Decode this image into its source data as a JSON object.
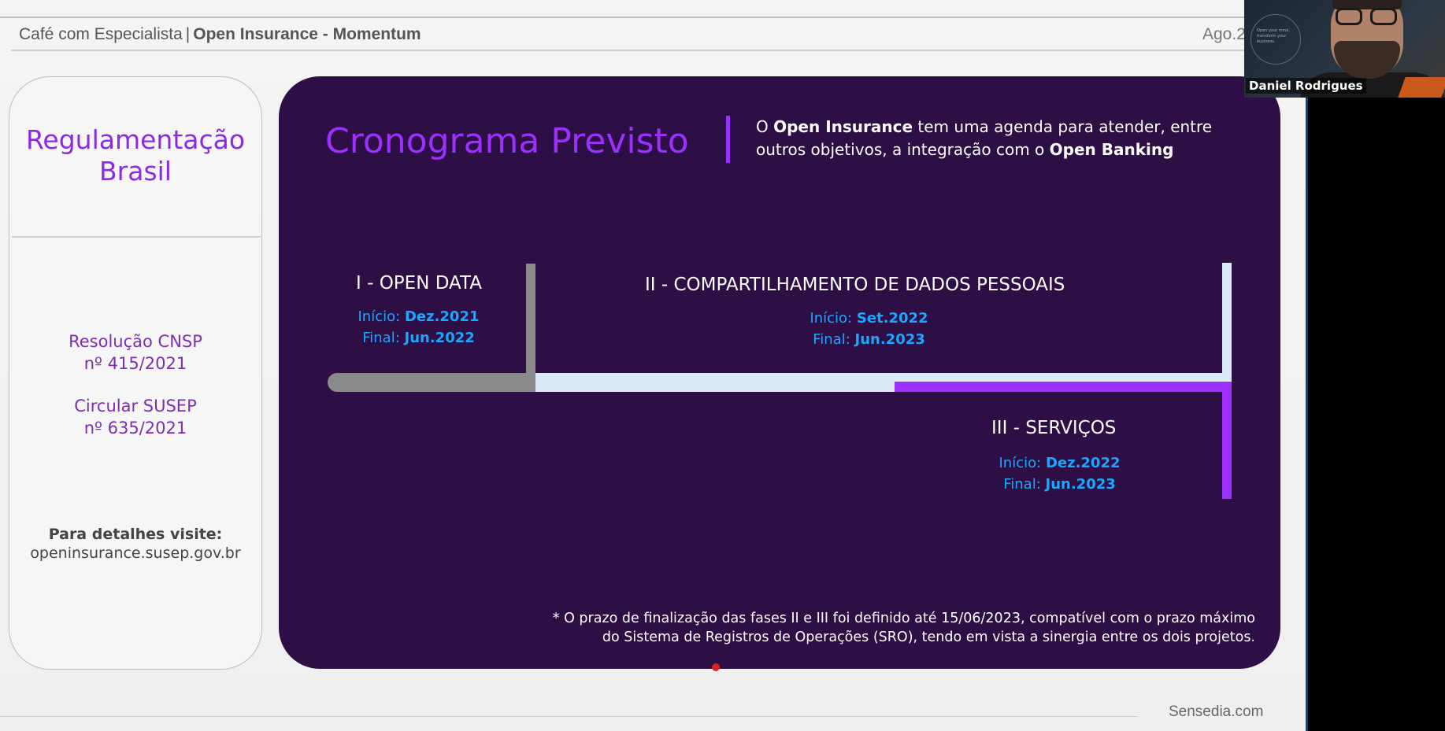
{
  "header": {
    "brand": "Café com Especialista",
    "separator": "|",
    "title": "Open Insurance - Momentum",
    "date": "Ago.2"
  },
  "left_panel": {
    "title": "Regulamentação Brasil",
    "regulations": [
      {
        "line1": "Resolução CNSP",
        "line2": "nº 415/2021"
      },
      {
        "line1": "Circular SUSEP",
        "line2": "nº 635/2021"
      }
    ],
    "details_label": "Para detalhes visite:",
    "details_url": "openinsurance.susep.gov.br"
  },
  "main_panel": {
    "title": "Cronograma Previsto",
    "intro": {
      "part1": "O ",
      "bold1": "Open Insurance",
      "part2": " tem uma agenda para atender, entre outros objetivos, a integração com o ",
      "bold2": "Open Banking"
    },
    "phases": [
      {
        "title": "I - OPEN DATA",
        "start_label": "Início:",
        "start": "Dez.2021",
        "end_label": "Final:",
        "end": "Jun.2022"
      },
      {
        "title": "II - COMPARTILHAMENTO DE DADOS PESSOAIS",
        "start_label": "Início:",
        "start": "Set.2022",
        "end_label": "Final:",
        "end": "Jun.2023"
      },
      {
        "title": "III - SERVIÇOS",
        "start_label": "Início:",
        "start": "Dez.2022",
        "end_label": "Final:",
        "end": "Jun.2023"
      }
    ],
    "timeline_colors": {
      "phase1": "#8a8a8a",
      "phase2": "#dbeaf8",
      "phase3": "#9b30ff"
    },
    "footnote_line1": "* O prazo de finalização das fases II e III foi definido até 15/06/2023, compatível com o prazo máximo",
    "footnote_line2": "do Sistema de Registros de Operações (SRO), tendo em vista a sinergia entre os dois projetos."
  },
  "footer": {
    "site": "Sensedia.com"
  },
  "webcam": {
    "participant_name": "Daniel Rodrigues",
    "background_text": "Open your mind, transform your business."
  },
  "colors": {
    "accent": "#9b30ff",
    "panel_bg": "#2d0f46",
    "date_blue": "#19a7ff"
  }
}
